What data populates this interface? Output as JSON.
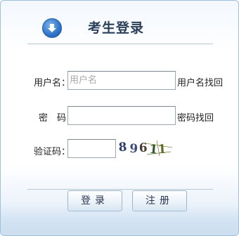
{
  "header": {
    "icon": "download-arrow-icon",
    "title": "考生登录"
  },
  "form": {
    "username_label": "用户名：",
    "username_placeholder": "用户名",
    "username_value": "",
    "find_username_link": "用户名找回",
    "password_label": "密　码：",
    "password_value": "",
    "find_password_link": "密码找回",
    "captcha_label": "验证码：",
    "captcha_value": "",
    "captcha_chars": [
      "8",
      "9",
      "6",
      "1",
      "1"
    ],
    "captcha_colors": [
      "#2c3e6b",
      "#3a4a7a",
      "#4a3a30",
      "#2f5a28",
      "#5a6a20"
    ]
  },
  "buttons": {
    "login_label": "登录",
    "register_label": "注册"
  },
  "colors": {
    "title_text": "#2a3f5a",
    "border": "#9fc0dc",
    "icon_blue": "#2f73c7"
  }
}
